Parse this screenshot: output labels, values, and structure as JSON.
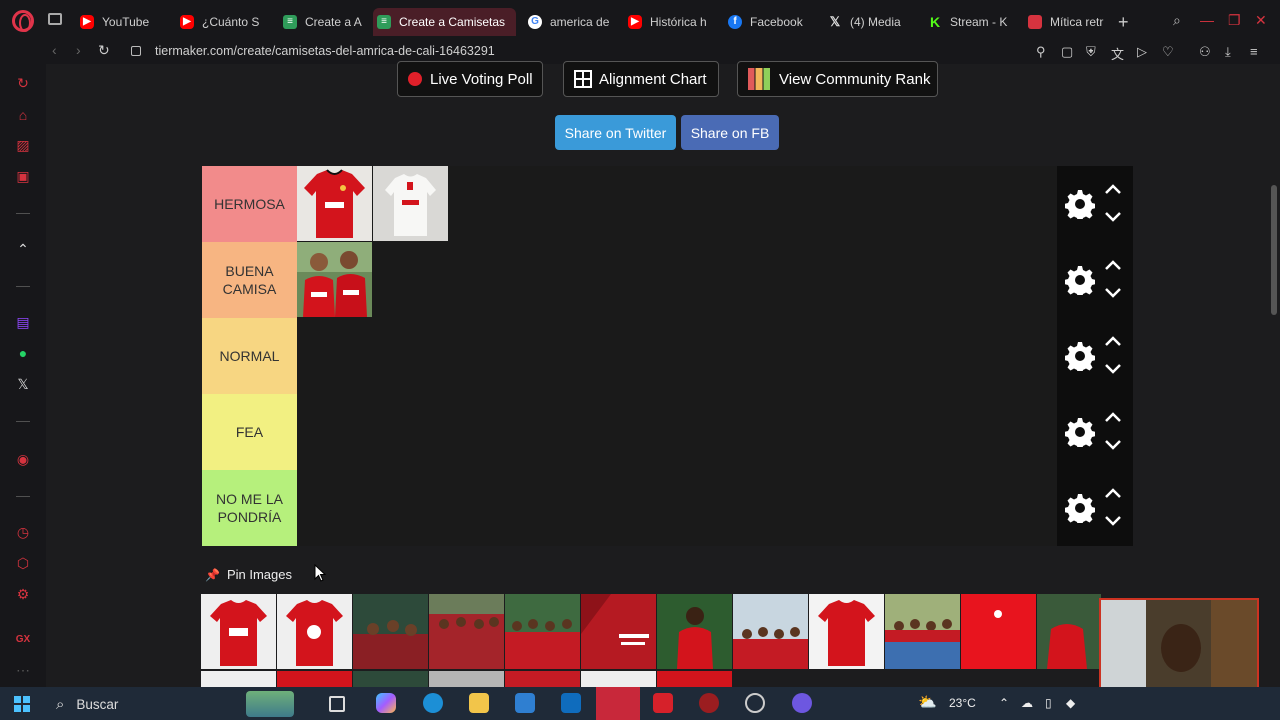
{
  "browser": {
    "tabs": [
      {
        "label": "YouTube",
        "icon": "youtube-icon",
        "kind": "yt"
      },
      {
        "label": "¿Cuánto S",
        "icon": "youtube-icon",
        "kind": "yt"
      },
      {
        "label": "Create a A",
        "icon": "tiermaker-icon",
        "kind": "tm"
      },
      {
        "label": "Create a Camisetas",
        "icon": "tiermaker-icon",
        "kind": "tm",
        "active": true
      },
      {
        "label": "america de",
        "icon": "google-icon",
        "kind": "g"
      },
      {
        "label": "Histórica h",
        "icon": "youtube-icon",
        "kind": "yt"
      },
      {
        "label": "Facebook",
        "icon": "facebook-icon",
        "kind": "fb"
      },
      {
        "label": "(4) Media",
        "icon": "x-icon",
        "kind": "x"
      },
      {
        "label": "Stream - K",
        "icon": "kick-icon",
        "kind": "k"
      },
      {
        "label": "Mítica retr",
        "icon": "page-icon",
        "kind": "mt"
      }
    ],
    "url": "tiermaker.com/create/camisetas-del-amrica-de-cali-16463291"
  },
  "toolbar": {
    "live_voting_label": "Live Voting Poll",
    "alignment_label": "Alignment Chart",
    "community_rank_label": "View Community Rank",
    "share_twitter_label": "Share on Twitter",
    "share_fb_label": "Share on FB"
  },
  "tiers": [
    {
      "label": "HERMOSA",
      "color": "#f28b8b",
      "items": [
        "red-shirt",
        "white-shirt"
      ]
    },
    {
      "label": "BUENA CAMISA",
      "color": "#f7b582",
      "items": [
        "players-photo"
      ]
    },
    {
      "label": "NORMAL",
      "color": "#f7d682",
      "items": []
    },
    {
      "label": "FEA",
      "color": "#f2f082",
      "items": []
    },
    {
      "label": "NO ME LA PONDRÍA",
      "color": "#b6f07c",
      "items": []
    }
  ],
  "pin_images_label": "Pin Images",
  "taskbar": {
    "search_placeholder": "Buscar",
    "temperature": "23°C"
  },
  "colors": {
    "accent": "#d6333f",
    "twitter": "#3a9ad9",
    "facebook": "#4a6bb5"
  }
}
